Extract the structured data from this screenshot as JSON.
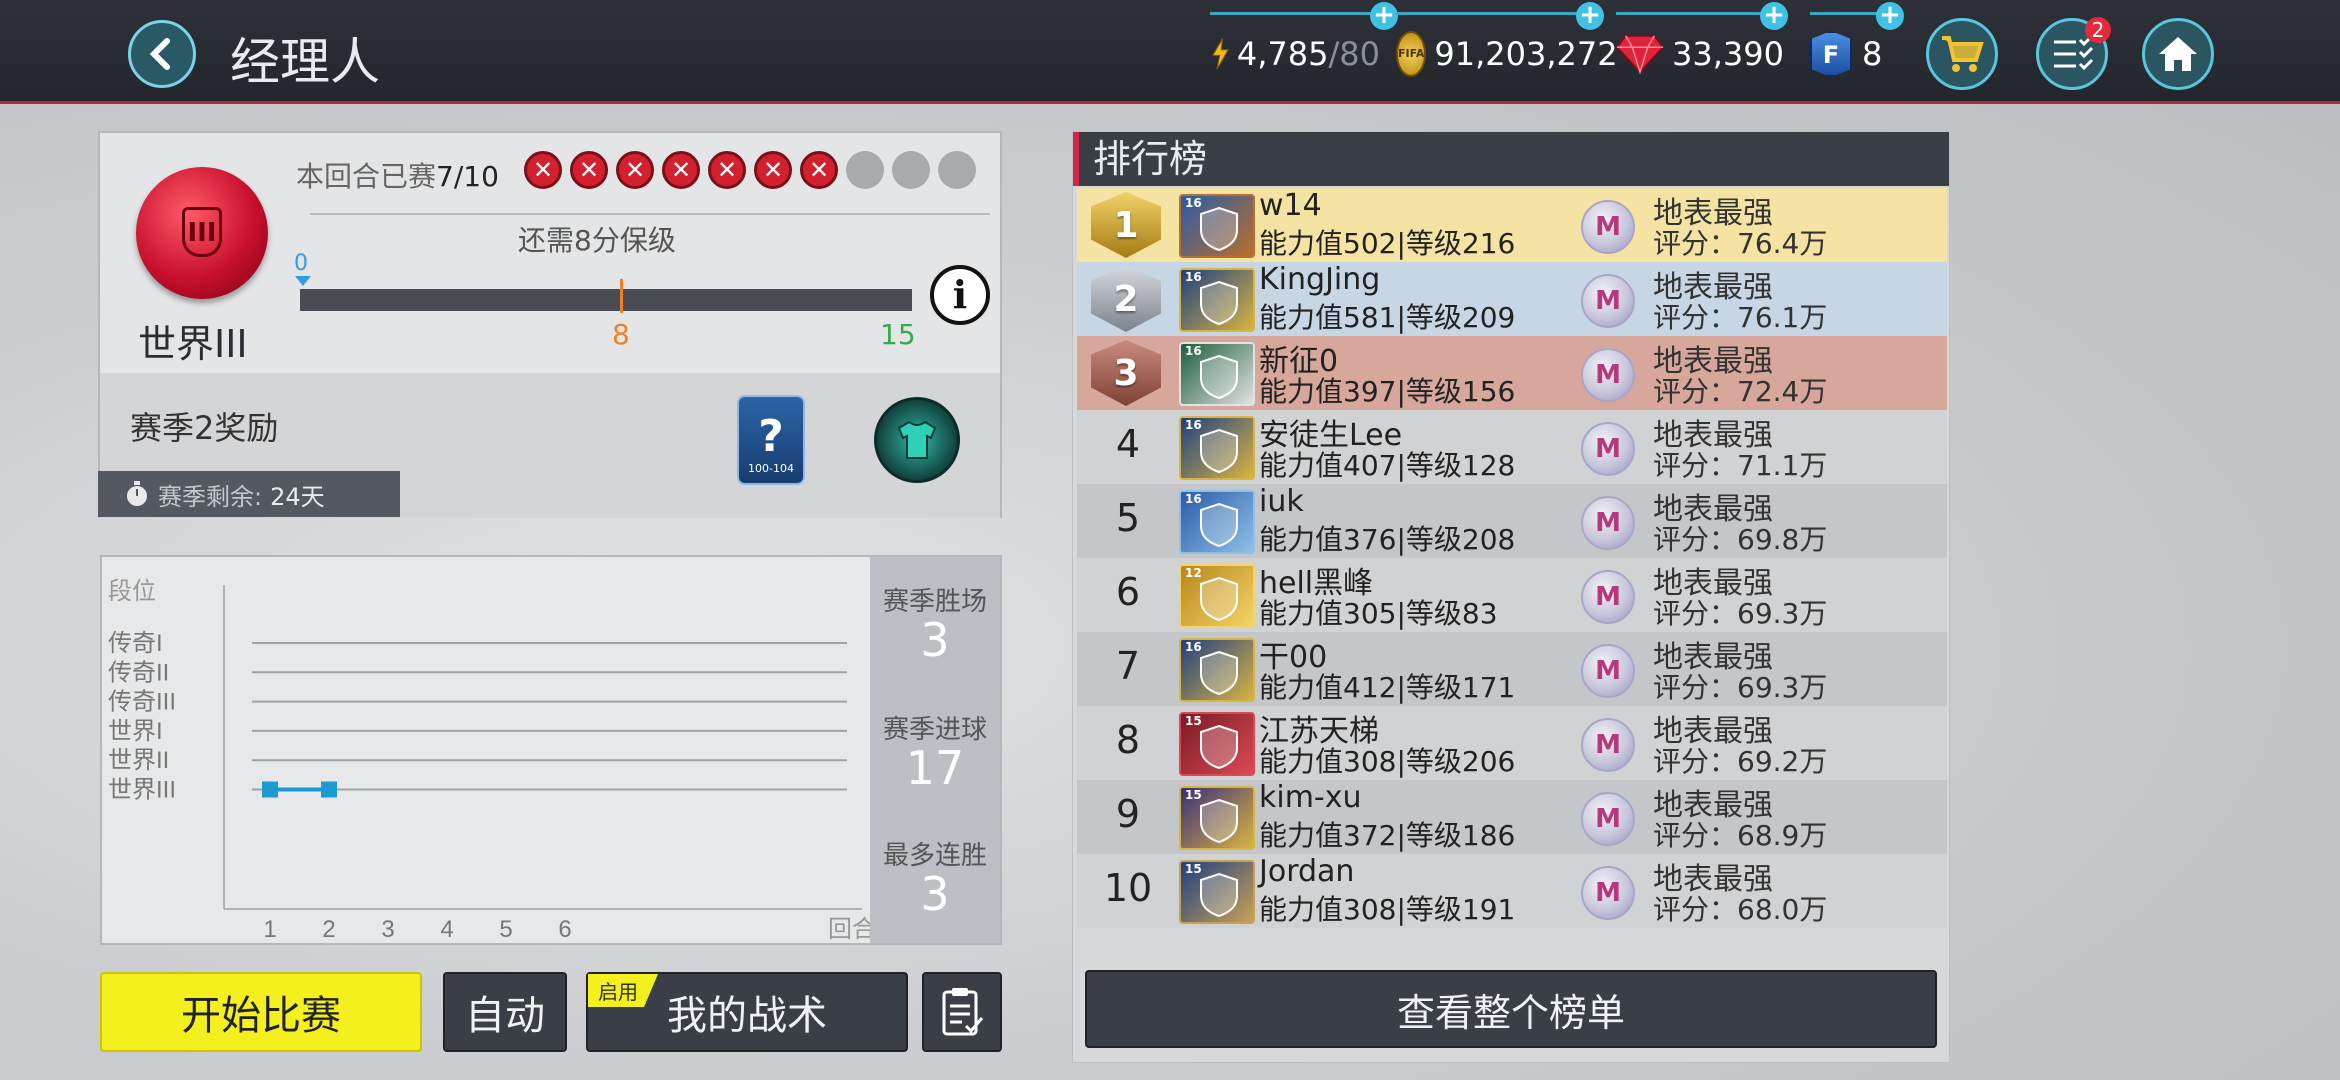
{
  "header": {
    "title": "经理人",
    "energy": "4,785",
    "energy_max": "/80",
    "coins": "91,203,272",
    "gems": "33,390",
    "fifa_points": "8",
    "tasks_badge": "2"
  },
  "division_card": {
    "division_name": "世界III",
    "played_label": "本回合已赛",
    "played_value": "7/10",
    "match_results": [
      "loss",
      "loss",
      "loss",
      "loss",
      "loss",
      "loss",
      "loss",
      "empty",
      "empty",
      "empty"
    ],
    "points_needed": "还需8分保级",
    "progress_start": "0",
    "progress_mark": "8",
    "progress_end": "15",
    "reward_title": "赛季2奖励",
    "mystery_range": "100-104",
    "season_remaining_label": "赛季剩余:",
    "season_remaining_value": "24天"
  },
  "chart_data": {
    "type": "line",
    "title": "",
    "ylabel": "段位",
    "xlabel": "回合",
    "y_categories": [
      "传奇I",
      "传奇II",
      "传奇III",
      "世界I",
      "世界II",
      "世界III"
    ],
    "x": [
      1,
      2,
      3,
      4,
      5,
      6
    ],
    "series": [
      {
        "values": [
          "世界III",
          "世界III",
          null,
          null,
          null,
          null
        ]
      }
    ]
  },
  "stats": {
    "wins_label": "赛季胜场",
    "wins": "3",
    "goals_label": "赛季进球",
    "goals": "17",
    "streak_label": "最多连胜",
    "streak": "3"
  },
  "actions": {
    "start": "开始比赛",
    "auto": "自动",
    "enabled_tag": "启用",
    "tactics": "我的战术"
  },
  "leaderboard": {
    "title": "排行榜",
    "view_all": "查看整个榜单",
    "rows": [
      {
        "rank": "1",
        "name": "w14",
        "stats": "能力值502|等级216",
        "lvl": "16",
        "tier": "地表最强",
        "score": "评分：76.4万"
      },
      {
        "rank": "2",
        "name": "KingJing",
        "stats": "能力值581|等级209",
        "lvl": "16",
        "tier": "地表最强",
        "score": "评分：76.1万"
      },
      {
        "rank": "3",
        "name": "新征0",
        "stats": "能力值397|等级156",
        "lvl": "16",
        "tier": "地表最强",
        "score": "评分：72.4万"
      },
      {
        "rank": "4",
        "name": "安徒生Lee",
        "stats": "能力值407|等级128",
        "lvl": "16",
        "tier": "地表最强",
        "score": "评分：71.1万"
      },
      {
        "rank": "5",
        "name": "iuk",
        "stats": "能力值376|等级208",
        "lvl": "16",
        "tier": "地表最强",
        "score": "评分：69.8万"
      },
      {
        "rank": "6",
        "name": "hell黑峰",
        "stats": "能力值305|等级83",
        "lvl": "12",
        "tier": "地表最强",
        "score": "评分：69.3万"
      },
      {
        "rank": "7",
        "name": "干00",
        "stats": "能力值412|等级171",
        "lvl": "16",
        "tier": "地表最强",
        "score": "评分：69.3万"
      },
      {
        "rank": "8",
        "name": "江苏天梯",
        "stats": "能力值308|等级206",
        "lvl": "15",
        "tier": "地表最强",
        "score": "评分：69.2万"
      },
      {
        "rank": "9",
        "name": "kim-xu",
        "stats": "能力值372|等级186",
        "lvl": "15",
        "tier": "地表最强",
        "score": "评分：68.9万"
      },
      {
        "rank": "10",
        "name": "Jordan",
        "stats": "能力值308|等级191",
        "lvl": "15",
        "tier": "地表最强",
        "score": "评分：68.0万"
      }
    ]
  },
  "colors": {
    "accent": "#3fc2e4",
    "start_button": "#f4f01e",
    "rank1_bg": "#f5e3a3",
    "rank2_bg": "#c6d6e4",
    "rank3_bg": "#d7a79c"
  }
}
